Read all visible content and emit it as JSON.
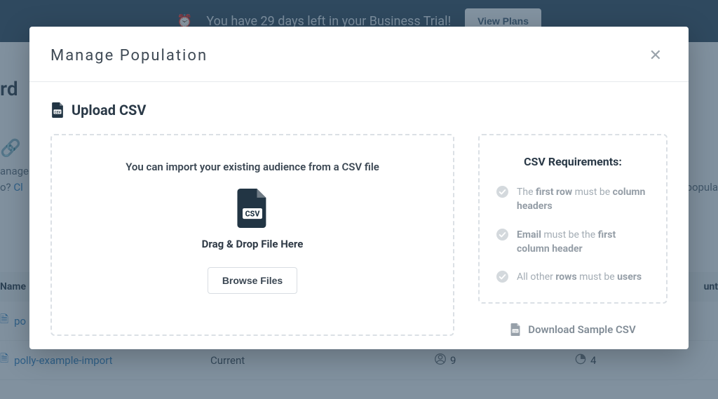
{
  "banner": {
    "text": "You have 29 days left in your Business Trial!",
    "button": "View Plans"
  },
  "bg": {
    "title_suffix": "rd",
    "desc_prefix": "anage",
    "desc_line2a": "o? ",
    "desc_link": "Cl",
    "desc_right1": "r popula",
    "col_name": "Name",
    "col_count": "unt",
    "rows": [
      {
        "name": "po",
        "status": "",
        "users": "",
        "count": ""
      },
      {
        "name": "polly-example-import",
        "status": "Current",
        "users": "9",
        "count": "4"
      }
    ]
  },
  "modal": {
    "title": "Manage Population",
    "section_title": "Upload CSV",
    "import_text": "You can import your existing audience from a CSV file",
    "drop_text": "Drag & Drop File Here",
    "browse_button": "Browse Files",
    "requirements": {
      "title": "CSV Requirements:",
      "items": [
        {
          "pre": "The ",
          "b1": "first row",
          "mid": " must be ",
          "b2": "column headers",
          "post": ""
        },
        {
          "pre": "",
          "b1": "Email",
          "mid": " must be the ",
          "b2": "first column header",
          "post": ""
        },
        {
          "pre": "All other ",
          "b1": "rows",
          "mid": " must be ",
          "b2": "users",
          "post": ""
        }
      ]
    },
    "download_label": "Download Sample CSV"
  }
}
